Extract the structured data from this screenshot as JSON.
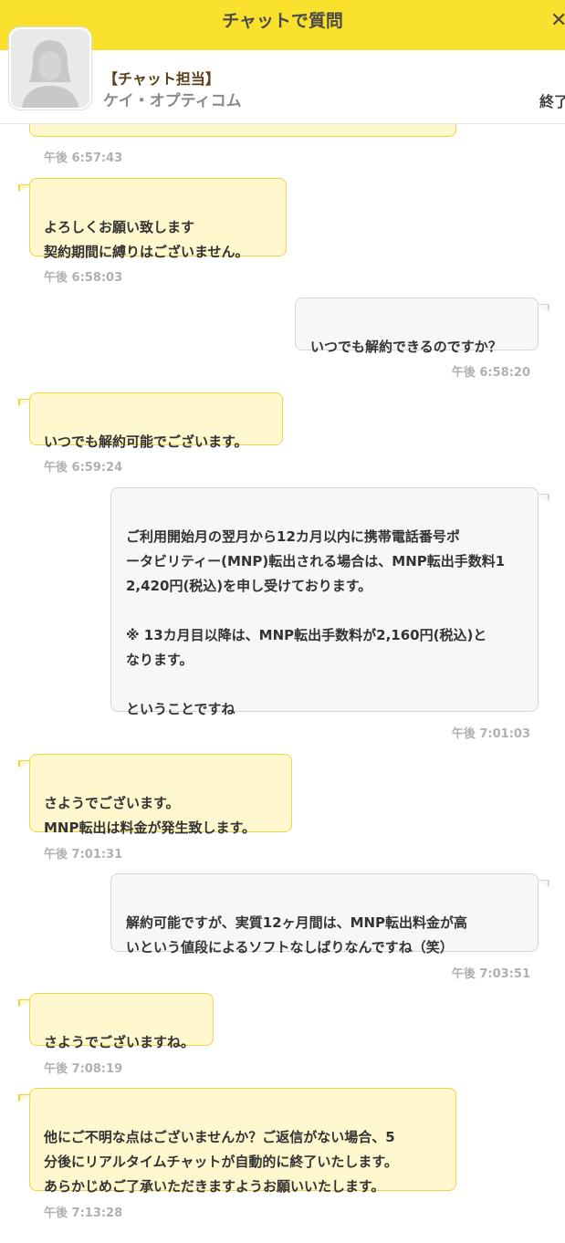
{
  "header": {
    "title": "チャットで質問",
    "close_icon": "close-icon"
  },
  "agent": {
    "role": "【チャット担当】",
    "company": "ケイ・オプティコム",
    "end_label": "終了",
    "avatar_icon": "person-silhouette-icon"
  },
  "colors": {
    "header_bg": "#f9e12e",
    "agent_bubble_bg": "#fff8cf",
    "agent_bubble_border": "#f0d440",
    "user_bubble_bg": "#f7f7f7",
    "user_bubble_border": "#d6d6d6",
    "timestamp": "#b0b0b0"
  },
  "messages": [
    {
      "sender": "agent",
      "text": "",
      "time": "午後 6:57:43"
    },
    {
      "sender": "agent",
      "text": "よろしくお願い致します\n契約期間に縛りはございません。",
      "time": "午後 6:58:03"
    },
    {
      "sender": "user",
      "text": "いつでも解約できるのですか？",
      "time": "午後 6:58:20"
    },
    {
      "sender": "agent",
      "text": "いつでも解約可能でございます。",
      "time": "午後 6:59:24"
    },
    {
      "sender": "user",
      "text": "ご利用開始月の翌月から12カ月以内に携帯電話番号ポ\nータビリティー(MNP)転出される場合は、MNP転出手数料1\n2,420円(税込)を申し受けております。\n\n※ 13カ月目以降は、MNP転出手数料が2,160円(税込)と\nなります。\n\nということですね",
      "time": "午後 7:01:03"
    },
    {
      "sender": "agent",
      "text": "さようでございます。\nMNP転出は料金が発生致します。",
      "time": "午後 7:01:31"
    },
    {
      "sender": "user",
      "text": "解約可能ですが、実質12ヶ月間は、MNP転出料金が高\nいという値段によるソフトなしばりなんですね（笑）",
      "time": "午後 7:03:51"
    },
    {
      "sender": "agent",
      "text": "さようでございますね。",
      "time": "午後 7:08:19"
    },
    {
      "sender": "agent",
      "text": "他にご不明な点はございませんか？ご返信がない場合、5\n分後にリアルタイムチャットが自動的に終了いたします。\nあらかじめご了承いただきますようお願いいたします。",
      "time": "午後 7:13:28"
    }
  ]
}
